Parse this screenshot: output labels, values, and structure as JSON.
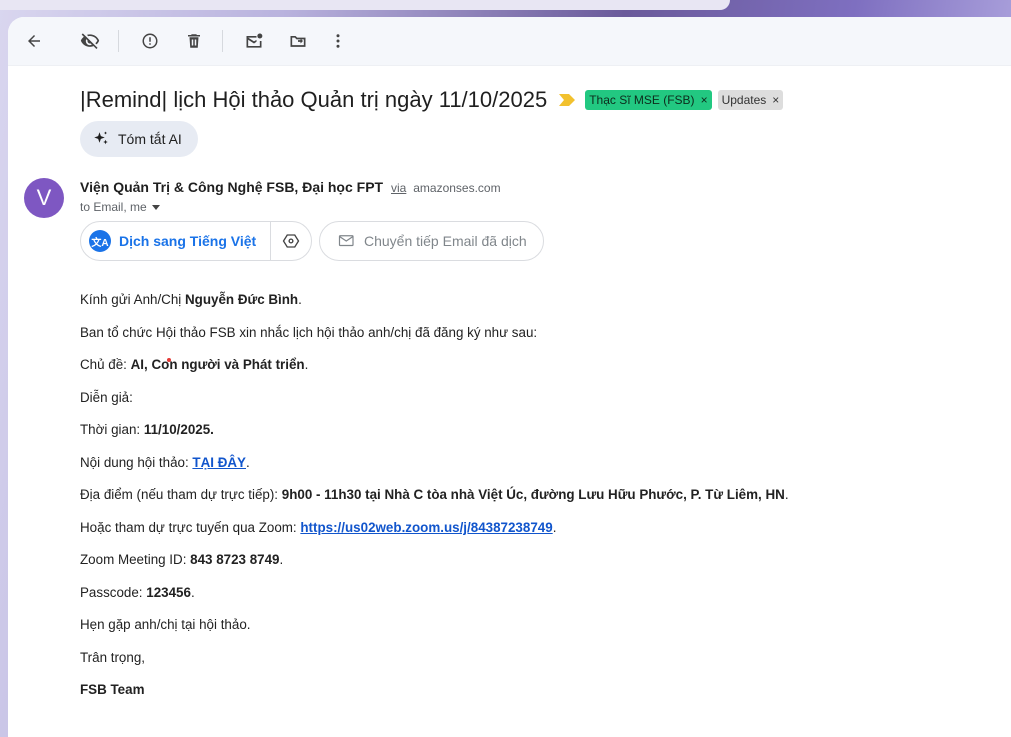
{
  "toolbar": {
    "icons": [
      "back-arrow-icon",
      "eye-off-icon",
      "report-icon",
      "trash-icon",
      "mark-unread-icon",
      "move-to-icon",
      "more-vert-icon"
    ]
  },
  "email": {
    "subject": "|Remind| lịch Hội thảo Quản trị ngày 11/10/2025",
    "labels": [
      {
        "text": "Thạc Sĩ MSE (FSB)",
        "color": "#22c881",
        "close": "×"
      },
      {
        "text": "Updates",
        "color": "#dddddd",
        "close": "×"
      }
    ],
    "summary_label": "Tóm tắt AI",
    "avatar_letter": "V",
    "avatar_color": "#7e57c2",
    "sender_name": "Viện Quản Trị & Công Nghệ FSB, Đại học FPT",
    "via_label": "via",
    "sender_domain": "amazonses.com",
    "recipients": "to Email, me",
    "translate_label": "Dịch sang Tiếng Việt",
    "forward_translated_label": "Chuyển tiếp Email đã dịch"
  },
  "body": {
    "greeting_prefix": "Kính gửi Anh/Chị ",
    "greeting_name": "Nguyễn Đức Bình",
    "greeting_suffix": ".",
    "intro": "Ban tổ chức Hội thảo FSB xin nhắc lịch hội thảo anh/chị đã đăng ký như sau:",
    "topic_prefix": "Chủ đề: ",
    "topic_value_a": "AI, Co",
    "topic_value_b": "n người và Phát triển",
    "topic_suffix": ".",
    "speaker": "Diễn giả:",
    "time_prefix": "Thời gian: ",
    "time_value": "11/10/2025.",
    "content_prefix": "Nội dung hội thảo: ",
    "content_link": "TẠI ĐÂY",
    "content_suffix": ".",
    "location_prefix": "Địa điểm (nếu tham dự trực tiếp): ",
    "location_value": "9h00 - 11h30 tại Nhà C tòa nhà Việt Úc, đường Lưu Hữu Phước, P. Từ Liêm, HN",
    "location_suffix": ".",
    "zoom_prefix": "Hoặc tham dự trực tuyến qua Zoom: ",
    "zoom_link": "https://us02web.zoom.us/j/84387238749",
    "zoom_suffix": ".",
    "meeting_id_prefix": "Zoom Meeting ID: ",
    "meeting_id_value": "843 8723 8749",
    "meeting_id_suffix": ".",
    "passcode_prefix": "Passcode: ",
    "passcode_value": "123456",
    "passcode_suffix": ".",
    "closing": "Hẹn gặp anh/chị tại hội thảo.",
    "regards": "Trân trọng,",
    "signature": "FSB Team"
  }
}
